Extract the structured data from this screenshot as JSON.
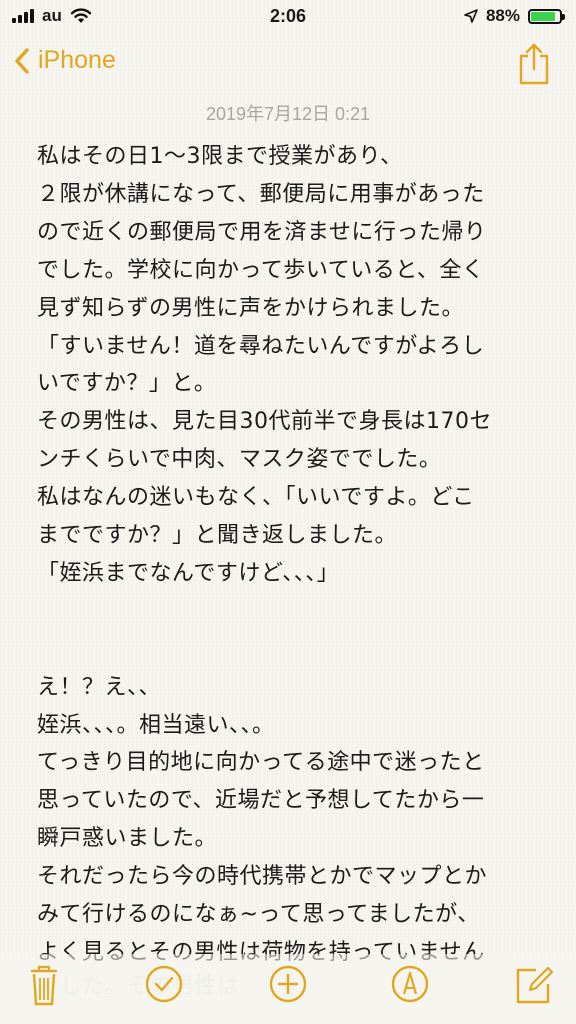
{
  "status_bar": {
    "carrier": "au",
    "time": "2:06",
    "battery_text": "88%",
    "battery_level": 0.88
  },
  "nav": {
    "back_label": "iPhone"
  },
  "note": {
    "date": "2019年7月12日 0:21",
    "lines": [
      "私はその日1〜3限まで授業があり、",
      "２限が休講になって、郵便局に用事があった",
      "ので近くの郵便局で用を済ませに行った帰り",
      "でした。学校に向かって歩いていると、全く",
      "見ず知らずの男性に声をかけられました。",
      "「すいません！道を尋ねたいんですがよろし",
      "いですか？」と。",
      "その男性は、見た目30代前半で身長は170セ",
      "ンチくらいで中肉、マスク姿ででした。",
      "私はなんの迷いもなく、「いいですよ。どこ",
      "までですか？」と聞き返しました。",
      "「姪浜までなんですけど、、、」",
      "",
      "",
      "え！？え、、",
      "姪浜、、、。相当遠い、、。",
      "てっきり目的地に向かってる途中で迷ったと",
      "思っていたので、近場だと予想してたから一",
      "瞬戸惑いました。",
      "それだったら今の時代携帯とかでマップとか",
      "みて行けるのになぁ~って思ってましたが、",
      "よく見るとその男性は荷物を持っていません"
    ]
  },
  "icons": {
    "wifi": "wifi-icon",
    "location": "location-arrow-icon",
    "share": "share-icon",
    "trash": "trash-icon",
    "checklist": "checklist-icon",
    "add": "add-icon",
    "markup": "markup-pen-icon",
    "compose": "compose-icon"
  },
  "colors": {
    "accent": "#e0a720",
    "background": "#f7f5ef",
    "battery": "#3cd34c",
    "date_text": "#a6a6a6"
  }
}
